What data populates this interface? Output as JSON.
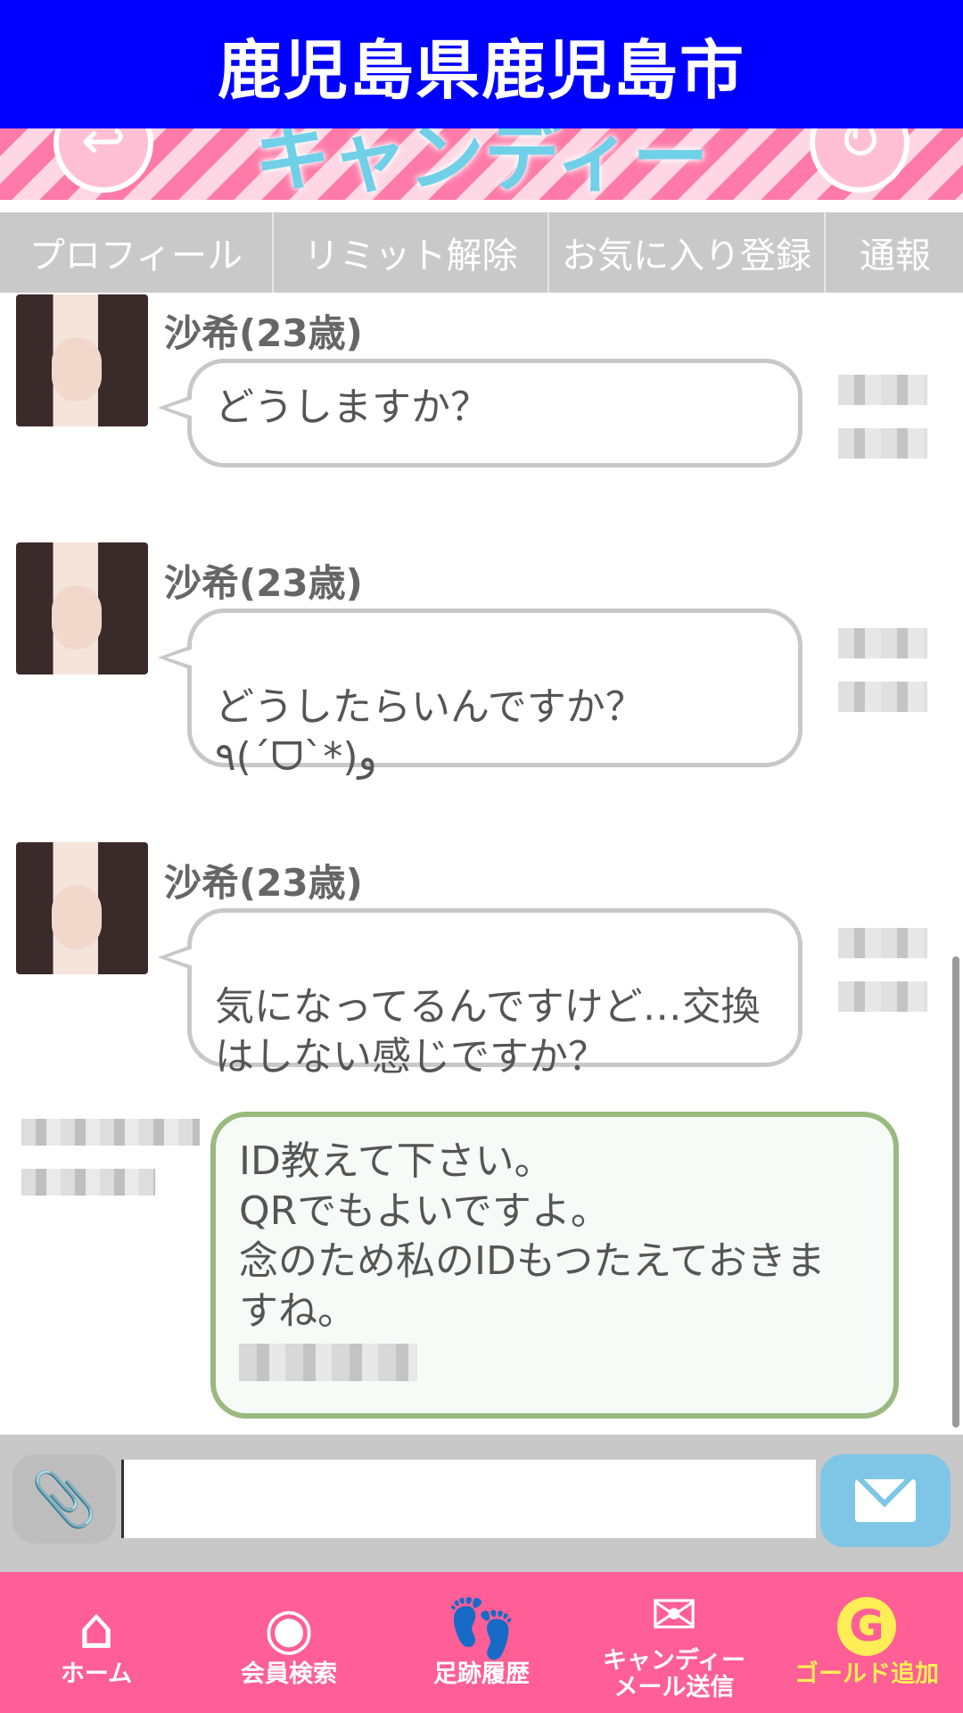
{
  "header": {
    "title": "鹿児島県鹿児島市"
  },
  "banner": {
    "logo_text": "キャンディー"
  },
  "tabs": [
    "プロフィール",
    "リミット解除",
    "お気に入り登録",
    "通報"
  ],
  "messages": [
    {
      "sender": "沙希(23歳)",
      "text": "どうしますか？"
    },
    {
      "sender": "沙希(23歳)",
      "text": "どうしたらいんですか？\n٩(ˊᗜˋ*)و"
    },
    {
      "sender": "沙希(23歳)",
      "text": "気になってるんですけど…交換\nはしない感じですか？"
    }
  ],
  "outgoing": {
    "lines": [
      "ID教えて下さい。",
      "QRでもよいですよ。",
      "念のため私のIDもつたえておきま",
      "すね。"
    ]
  },
  "composer": {
    "placeholder": ""
  },
  "nav": {
    "home": "ホーム",
    "search": "会員検索",
    "footprints": "足跡履歴",
    "mail": "キャンディー\nメール送信",
    "gold": "ゴールド追加"
  },
  "colors": {
    "header": "#0000ff",
    "nav": "#ff5e96",
    "outgoing_border": "#9ab97f",
    "send": "#7fc6e6"
  }
}
